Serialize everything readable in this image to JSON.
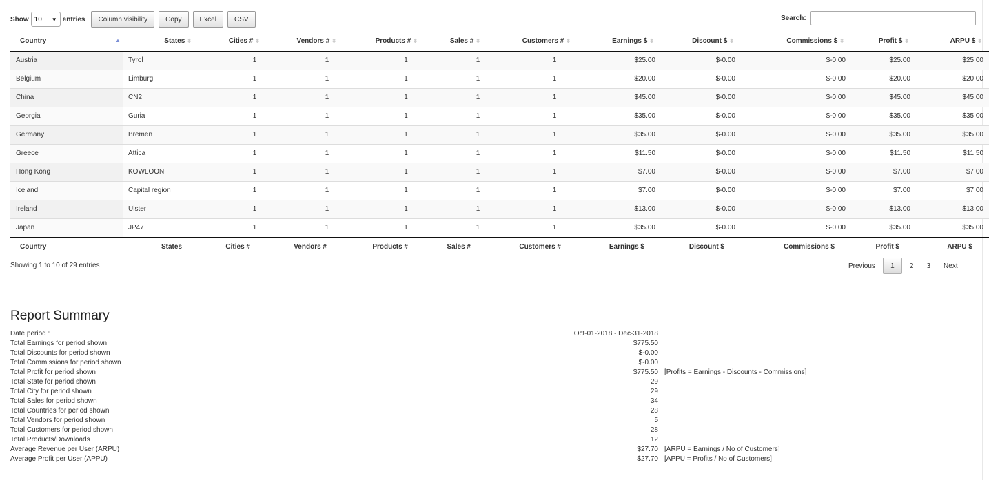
{
  "controls": {
    "show_label": "Show",
    "entries_label": "entries",
    "page_length": "10",
    "buttons": [
      "Column visibility",
      "Copy",
      "Excel",
      "CSV"
    ],
    "search_label": "Search:",
    "search_value": ""
  },
  "table": {
    "columns": [
      "Country",
      "States",
      "Cities #",
      "Vendors #",
      "Products #",
      "Sales #",
      "Customers #",
      "Earnings $",
      "Discount $",
      "Commissions $",
      "Profit $",
      "ARPU $"
    ],
    "rows": [
      [
        "Austria",
        "Tyrol",
        "1",
        "1",
        "1",
        "1",
        "1",
        "$25.00",
        "$-0.00",
        "$-0.00",
        "$25.00",
        "$25.00"
      ],
      [
        "Belgium",
        "Limburg",
        "1",
        "1",
        "1",
        "1",
        "1",
        "$20.00",
        "$-0.00",
        "$-0.00",
        "$20.00",
        "$20.00"
      ],
      [
        "China",
        "CN2",
        "1",
        "1",
        "1",
        "1",
        "1",
        "$45.00",
        "$-0.00",
        "$-0.00",
        "$45.00",
        "$45.00"
      ],
      [
        "Georgia",
        "Guria",
        "1",
        "1",
        "1",
        "1",
        "1",
        "$35.00",
        "$-0.00",
        "$-0.00",
        "$35.00",
        "$35.00"
      ],
      [
        "Germany",
        "Bremen",
        "1",
        "1",
        "1",
        "1",
        "1",
        "$35.00",
        "$-0.00",
        "$-0.00",
        "$35.00",
        "$35.00"
      ],
      [
        "Greece",
        "Attica",
        "1",
        "1",
        "1",
        "1",
        "1",
        "$11.50",
        "$-0.00",
        "$-0.00",
        "$11.50",
        "$11.50"
      ],
      [
        "Hong Kong",
        "KOWLOON",
        "1",
        "1",
        "1",
        "1",
        "1",
        "$7.00",
        "$-0.00",
        "$-0.00",
        "$7.00",
        "$7.00"
      ],
      [
        "Iceland",
        "Capital region",
        "1",
        "1",
        "1",
        "1",
        "1",
        "$7.00",
        "$-0.00",
        "$-0.00",
        "$7.00",
        "$7.00"
      ],
      [
        "Ireland",
        "Ulster",
        "1",
        "1",
        "1",
        "1",
        "1",
        "$13.00",
        "$-0.00",
        "$-0.00",
        "$13.00",
        "$13.00"
      ],
      [
        "Japan",
        "JP47",
        "1",
        "1",
        "1",
        "1",
        "1",
        "$35.00",
        "$-0.00",
        "$-0.00",
        "$35.00",
        "$35.00"
      ]
    ]
  },
  "pagination": {
    "info": "Showing 1 to 10 of 29 entries",
    "previous": "Previous",
    "pages": [
      "1",
      "2",
      "3"
    ],
    "next": "Next"
  },
  "summary": {
    "title": "Report Summary",
    "rows": [
      {
        "label": "Date period :",
        "value": "Oct-01-2018 - Dec-31-2018",
        "note": ""
      },
      {
        "label": "Total Earnings for period shown",
        "value": "$775.50",
        "note": ""
      },
      {
        "label": "Total Discounts for period shown",
        "value": "$-0.00",
        "note": ""
      },
      {
        "label": "Total Commissions for period shown",
        "value": "$-0.00",
        "note": ""
      },
      {
        "label": "Total Profit for period shown",
        "value": "$775.50",
        "note": "[Profits = Earnings - Discounts - Commissions]"
      },
      {
        "label": "Total State for period shown",
        "value": "29",
        "note": ""
      },
      {
        "label": "Total City for period shown",
        "value": "29",
        "note": ""
      },
      {
        "label": "Total Sales for period shown",
        "value": "34",
        "note": ""
      },
      {
        "label": "Total Countries for period shown",
        "value": "28",
        "note": ""
      },
      {
        "label": "Total Vendors for period shown",
        "value": "5",
        "note": ""
      },
      {
        "label": "Total Customers for period shown",
        "value": "28",
        "note": ""
      },
      {
        "label": "Total Products/Downloads",
        "value": "12",
        "note": ""
      },
      {
        "label": "Average Revenue per User (ARPU)",
        "value": "$27.70",
        "note": "[ARPU = Earnings / No of Customers]"
      },
      {
        "label": "Average Profit per User (APPU)",
        "value": "$27.70",
        "note": "[APPU = Profits / No of Customers]"
      }
    ]
  }
}
